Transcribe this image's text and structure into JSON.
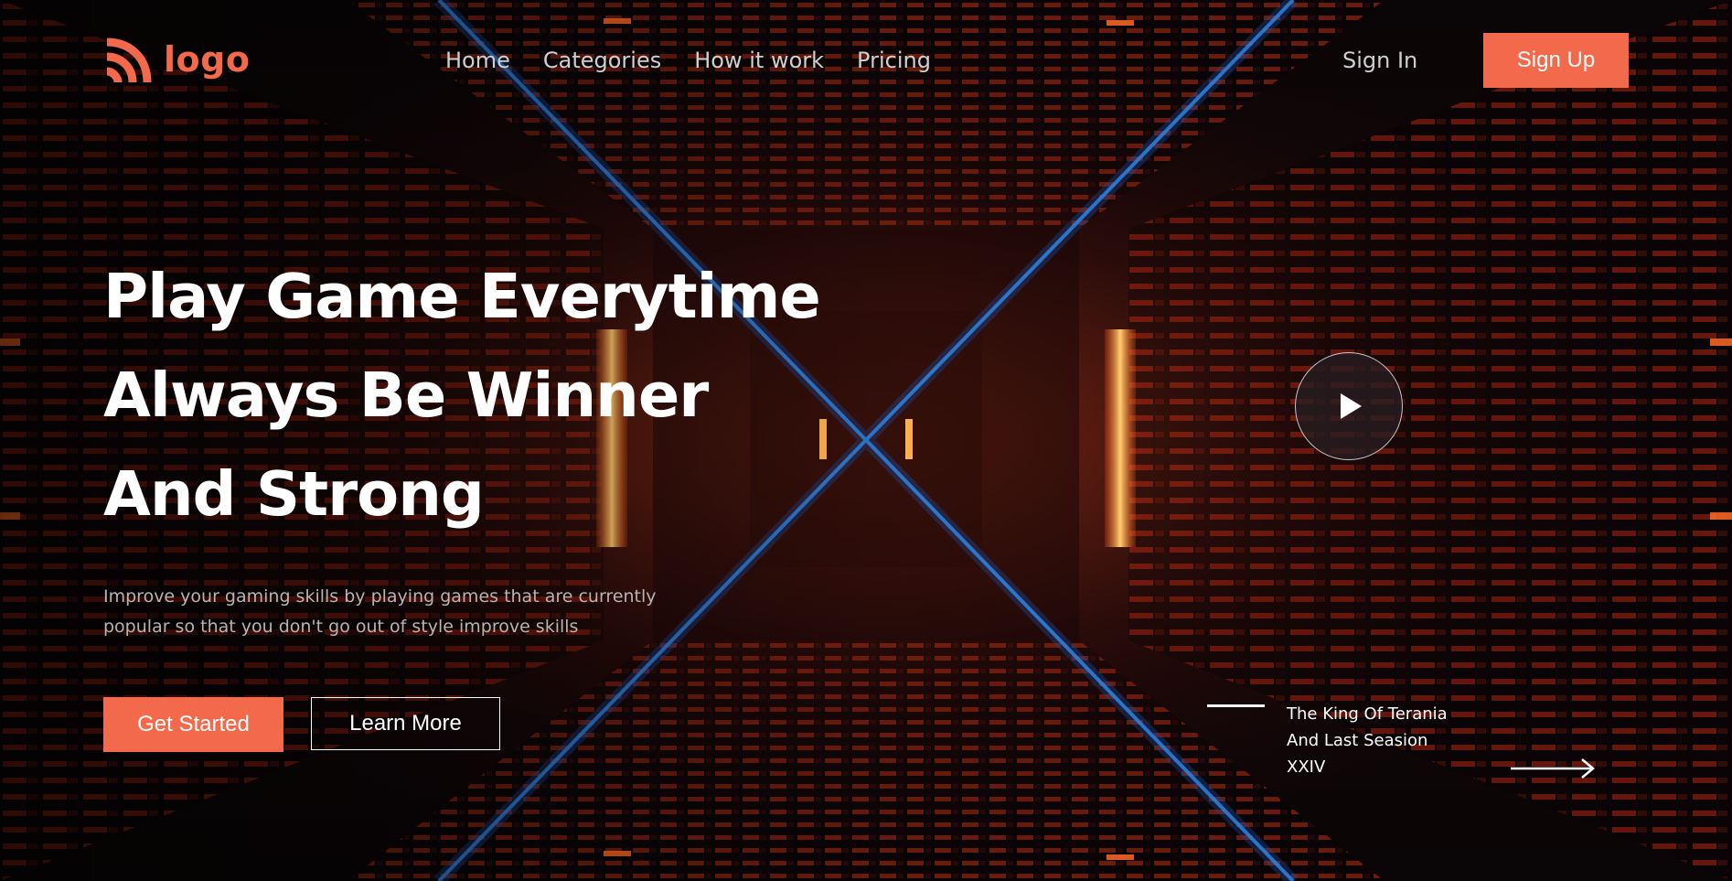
{
  "brand": {
    "logo_text": "logo",
    "accent_color": "#f26a4b",
    "logo_icon": "rss-wave-icon"
  },
  "nav": {
    "items": [
      {
        "label": "Home"
      },
      {
        "label": "Categories"
      },
      {
        "label": "How it work"
      },
      {
        "label": "Pricing"
      }
    ],
    "signin_label": "Sign In",
    "signup_label": "Sign Up"
  },
  "hero": {
    "headline_lines": [
      "Play Game Everytime",
      "Always Be Winner",
      "And Strong"
    ],
    "subtext": "Improve your gaming skills by playing games that are currently popular so that you don't go out of style improve skills",
    "primary_cta": "Get Started",
    "secondary_cta": "Learn More",
    "play_icon": "play-icon"
  },
  "featured": {
    "title_lines": [
      "The King Of Terania",
      "And Last Seasion",
      "XXIV"
    ],
    "arrow_icon": "arrow-right-icon"
  }
}
